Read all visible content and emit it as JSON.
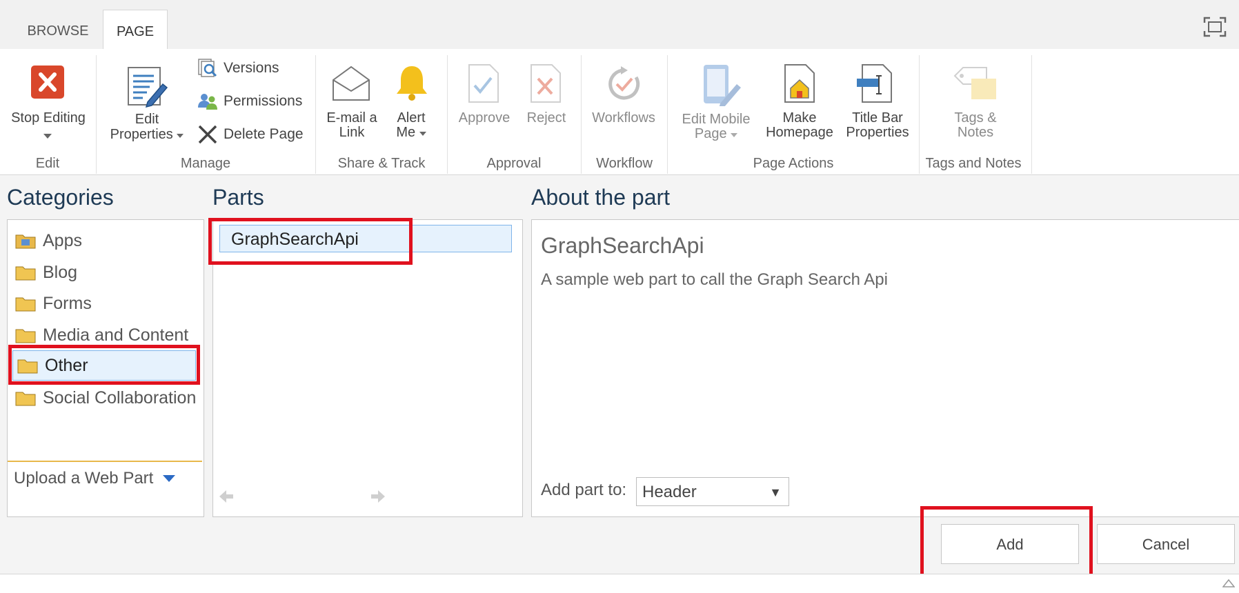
{
  "tabs": {
    "browse": "BROWSE",
    "page": "PAGE"
  },
  "ribbon": {
    "edit": {
      "stop_editing": "Stop Editing",
      "group": "Edit"
    },
    "manage": {
      "edit_properties_1": "Edit",
      "edit_properties_2": "Properties",
      "versions": "Versions",
      "permissions": "Permissions",
      "delete_page": "Delete Page",
      "group": "Manage"
    },
    "share": {
      "email_1": "E-mail a",
      "email_2": "Link",
      "alert_1": "Alert",
      "alert_2": "Me",
      "group": "Share & Track"
    },
    "approval": {
      "approve": "Approve",
      "reject": "Reject",
      "group": "Approval"
    },
    "workflow": {
      "workflows": "Workflows",
      "group": "Workflow"
    },
    "page_actions": {
      "edit_mobile_1": "Edit Mobile",
      "edit_mobile_2": "Page",
      "make_home_1": "Make",
      "make_home_2": "Homepage",
      "title_bar_1": "Title Bar",
      "title_bar_2": "Properties",
      "group": "Page Actions"
    },
    "tags": {
      "tags_1": "Tags &",
      "tags_2": "Notes",
      "group": "Tags and Notes"
    }
  },
  "categories": {
    "title": "Categories",
    "items": [
      {
        "label": "Apps"
      },
      {
        "label": "Blog"
      },
      {
        "label": "Forms"
      },
      {
        "label": "Media and Content"
      },
      {
        "label": "Other"
      },
      {
        "label": "Social Collaboration"
      }
    ],
    "selected": "Other",
    "upload": "Upload a Web Part"
  },
  "parts": {
    "title": "Parts",
    "items": [
      {
        "label": "GraphSearchApi"
      }
    ]
  },
  "about": {
    "title": "About the part",
    "name": "GraphSearchApi",
    "description": "A sample web part to call the Graph Search Api",
    "add_to_label": "Add part to:",
    "add_to_value": "Header"
  },
  "footer": {
    "add": "Add",
    "cancel": "Cancel"
  },
  "colors": {
    "highlight": "#e0111e",
    "selection_bg": "#e6f2fd",
    "selection_border": "#7eb4ea",
    "title": "#1e3a55"
  }
}
